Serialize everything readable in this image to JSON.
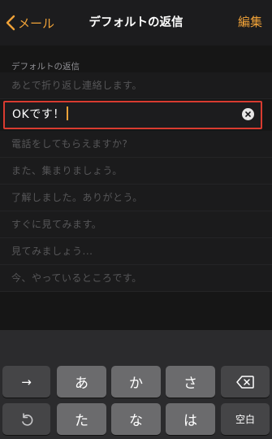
{
  "navbar": {
    "back_label": "メール",
    "title": "デフォルトの返信",
    "edit_label": "編集"
  },
  "section_header": "デフォルトの返信",
  "replies": [
    "あとで折り返し連絡します。",
    "OKです！",
    "電話をしてもらえますか?",
    "また、集まりましょう。",
    "了解しました。ありがとう。",
    "すぐに見てみます。",
    "見てみましょう...",
    "今、やっているところです。"
  ],
  "editing_index": 1,
  "keyboard": {
    "row1": [
      "→",
      "あ",
      "か",
      "さ",
      "⌫"
    ],
    "row2": [
      "↺",
      "た",
      "な",
      "は",
      "空白"
    ]
  },
  "colors": {
    "accent": "#f0a238",
    "focus_border": "#d93b30",
    "background": "#1c1c1e"
  }
}
